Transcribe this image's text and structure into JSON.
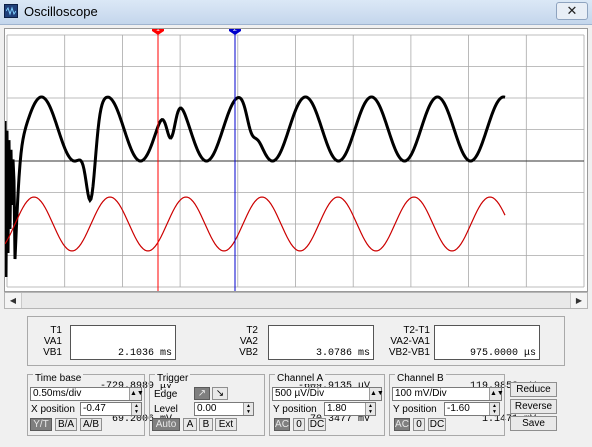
{
  "window": {
    "title": "Oscilloscope",
    "close_glyph": "✕"
  },
  "icons": {
    "app": "oscilloscope-icon",
    "close": "close-icon",
    "left": "scroll-left-icon",
    "right": "scroll-right-icon"
  },
  "cursors": {
    "t1_label": "1",
    "t2_label": "2",
    "t1_color": "#ff0000",
    "t2_color": "#0000cc"
  },
  "traces": {
    "channel_a_color": "#000000",
    "channel_b_color": "#cc0000",
    "screen_bg": "#ffffff",
    "grid_color": "#a9a9a9"
  },
  "readout": {
    "t1": {
      "label": "T1",
      "time": "2.1036 ms",
      "va_label": "VA1",
      "va": "-729.8989 μV",
      "vb_label": "VB1",
      "vb": "69.2006 mV"
    },
    "t2": {
      "label": "T2",
      "time": "3.0786 ms",
      "va_label": "VA2",
      "va": "-609.9135 μV",
      "vb_label": "VB2",
      "vb": "70.3477 mV"
    },
    "diff": {
      "label": "T2-T1",
      "time": "975.0000 μs",
      "va_label": "VA2-VA1",
      "va": "119.9853 μV",
      "vb_label": "VB2-VB1",
      "vb": "1.1471 mV"
    }
  },
  "timebase": {
    "title": "Time base",
    "scale": "0.50ms/div",
    "xpos_label": "X position",
    "xpos": "-0.47",
    "modes": [
      "Y/T",
      "B/A",
      "A/B"
    ],
    "active_mode": "Y/T"
  },
  "trigger": {
    "title": "Trigger",
    "edge_label": "Edge",
    "level_label": "Level",
    "level": "0.00",
    "edge_rise": "↗",
    "edge_fall": "↘",
    "sources": [
      "Auto",
      "A",
      "B",
      "Ext"
    ]
  },
  "channel_a": {
    "title": "Channel A",
    "scale": "500 µV/Div",
    "ypos_label": "Y position",
    "ypos": "1.80",
    "coupling": [
      "AC",
      "0",
      "DC"
    ]
  },
  "channel_b": {
    "title": "Channel B",
    "scale": "100 mV/Div",
    "ypos_label": "Y position",
    "ypos": "-1.60",
    "coupling": [
      "AC",
      "0",
      "DC"
    ]
  },
  "actions": {
    "reduce": "Reduce",
    "reverse": "Reverse",
    "save": "Save"
  }
}
